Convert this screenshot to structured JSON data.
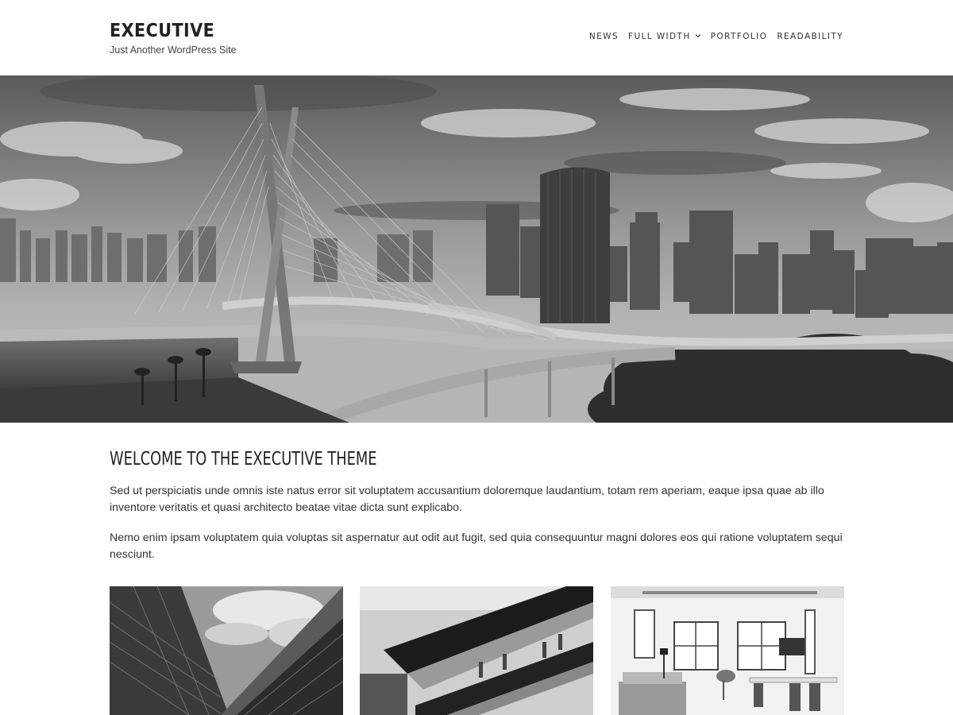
{
  "header": {
    "site_title": "EXECUTIVE",
    "tagline": "Just Another WordPress Site"
  },
  "nav": {
    "items": [
      {
        "label": "NEWS",
        "has_dropdown": false
      },
      {
        "label": "FULL WIDTH",
        "has_dropdown": true
      },
      {
        "label": "PORTFOLIO",
        "has_dropdown": false
      },
      {
        "label": "READABILITY",
        "has_dropdown": false
      }
    ],
    "dropdown_icon": "chevron-down-icon"
  },
  "hero": {
    "subject": "grayscale city skyline with cable-stayed bridge"
  },
  "main": {
    "title": "WELCOME TO THE EXECUTIVE THEME",
    "paragraphs": [
      "Sed ut perspiciatis unde omnis iste natus error sit voluptatem accusantium doloremque laudantium, totam rem aperiam, eaque ipsa quae ab illo inventore veritatis et quasi architecto beatae vitae dicta sunt explicabo.",
      "Nemo enim ipsam voluptatem quia voluptas sit aspernatur aut odit aut fugit, sed quia consequuntur magni dolores eos qui ratione voluptatem sequi nesciunt."
    ]
  },
  "gallery": {
    "items": [
      {
        "subject": "glass skyscrapers looking up"
      },
      {
        "subject": "escalators in shopping mall"
      },
      {
        "subject": "bright office interior"
      }
    ]
  },
  "colors": {
    "text": "#333333",
    "title": "#222222",
    "background": "#ffffff"
  }
}
